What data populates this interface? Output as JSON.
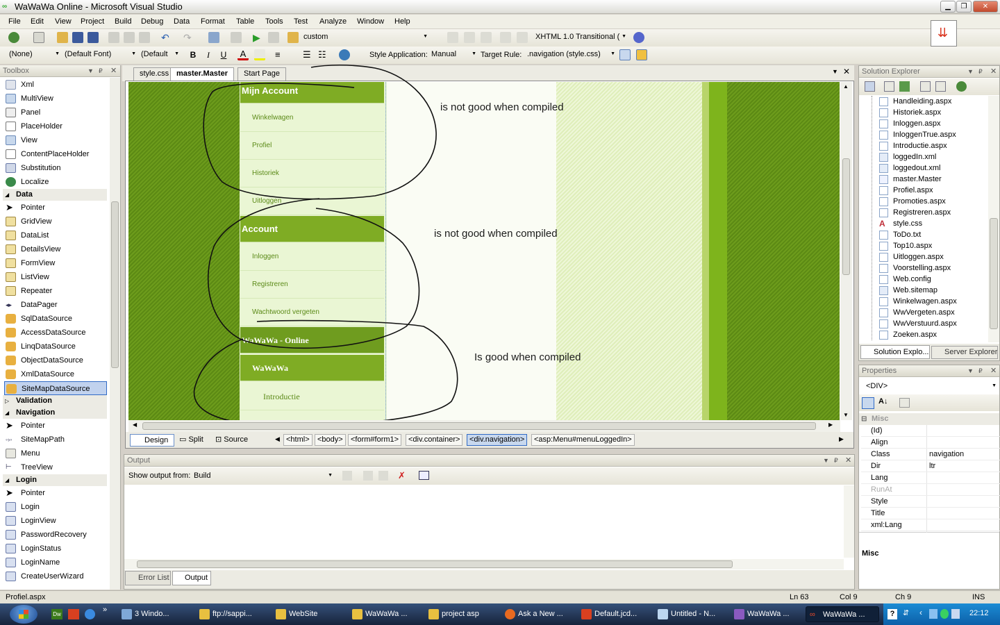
{
  "window": {
    "title": "WaWaWa Online - Microsoft Visual Studio"
  },
  "menu": [
    "File",
    "Edit",
    "View",
    "Project",
    "Build",
    "Debug",
    "Data",
    "Format",
    "Table",
    "Tools",
    "Test",
    "Analyze",
    "Window",
    "Help"
  ],
  "toolbar1": {
    "config": "custom",
    "doctype": "XHTML 1.0 Transitional ("
  },
  "toolbar2": {
    "style": "(None)",
    "font": "(Default Font)",
    "size": "(Default",
    "style_app_label": "Style Application:",
    "style_app": "Manual",
    "target_label": "Target Rule:",
    "target": ".navigation (style.css)"
  },
  "toolbox": {
    "title": "Toolbox",
    "items_top": [
      "Xml",
      "MultiView",
      "Panel",
      "PlaceHolder",
      "View",
      "ContentPlaceHolder",
      "Substitution",
      "Localize"
    ],
    "data_header": "Data",
    "data_items": [
      "Pointer",
      "GridView",
      "DataList",
      "DetailsView",
      "FormView",
      "ListView",
      "Repeater",
      "DataPager",
      "SqlDataSource",
      "AccessDataSource",
      "LinqDataSource",
      "ObjectDataSource",
      "XmlDataSource",
      "SiteMapDataSource"
    ],
    "validation_header": "Validation",
    "navigation_header": "Navigation",
    "navigation_items": [
      "Pointer",
      "SiteMapPath",
      "Menu",
      "TreeView"
    ],
    "login_header": "Login",
    "login_items": [
      "Pointer",
      "Login",
      "LoginView",
      "PasswordRecovery",
      "LoginStatus",
      "LoginName",
      "CreateUserWizard"
    ]
  },
  "doc_tabs": [
    "style.css",
    "master.Master",
    "Start Page"
  ],
  "design": {
    "menu1_header": "Mijn Account",
    "menu1_items": [
      "Winkelwagen",
      "Profiel",
      "Historiek",
      "Uitloggen"
    ],
    "menu2_header": "Account",
    "menu2_items": [
      "Inloggen",
      "Registreren",
      "Wachtwoord vergeten"
    ],
    "menu3_header": "WaWaWa - Online",
    "menu3_sub": "WaWaWa",
    "menu3_items": [
      "Introductie"
    ],
    "annotation1": "is not good when compiled",
    "annotation2": "is not good when compiled",
    "annotation3": "Is good when compiled"
  },
  "view_tabs": [
    "Design",
    "Split",
    "Source"
  ],
  "breadcrumb": [
    "<html>",
    "<body>",
    "<form#form1>",
    "<div.container>",
    "<div.navigation>",
    "<asp:Menu#menuLoggedIn>"
  ],
  "output": {
    "title": "Output",
    "show_label": "Show output from:",
    "source": "Build"
  },
  "bottom_tabs": [
    "Error List",
    "Output"
  ],
  "solution_explorer": {
    "title": "Solution Explorer",
    "files": [
      "Handleiding.aspx",
      "Historiek.aspx",
      "Inloggen.aspx",
      "InloggenTrue.aspx",
      "Introductie.aspx",
      "loggedIn.xml",
      "loggedout.xml",
      "master.Master",
      "Profiel.aspx",
      "Promoties.aspx",
      "Registreren.aspx",
      "style.css",
      "ToDo.txt",
      "Top10.aspx",
      "Uitloggen.aspx",
      "Voorstelling.aspx",
      "Web.config",
      "Web.sitemap",
      "Winkelwagen.aspx",
      "WwVergeten.aspx",
      "WwVerstuurd.aspx",
      "Zoeken.aspx"
    ],
    "tabs": [
      "Solution Explo...",
      "Server Explorer"
    ]
  },
  "properties": {
    "title": "Properties",
    "object": "<DIV>",
    "category": "Misc",
    "rows": [
      {
        "name": "(Id)",
        "value": ""
      },
      {
        "name": "Align",
        "value": ""
      },
      {
        "name": "Class",
        "value": "navigation"
      },
      {
        "name": "Dir",
        "value": "ltr"
      },
      {
        "name": "Lang",
        "value": ""
      },
      {
        "name": "RunAt",
        "value": ""
      },
      {
        "name": "Style",
        "value": ""
      },
      {
        "name": "Title",
        "value": ""
      },
      {
        "name": "xml:Lang",
        "value": ""
      }
    ],
    "desc": "Misc"
  },
  "status": {
    "file": "Profiel.aspx",
    "ln": "Ln 63",
    "col": "Col 9",
    "ch": "Ch 9",
    "mode": "INS"
  },
  "taskbar": {
    "items": [
      "3 Windo...",
      "ftp://sappi...",
      "WebSite",
      "WaWaWa ...",
      "project asp",
      "Ask a New ...",
      "Default.jcd...",
      "Untitled - N...",
      "WaWaWa ...",
      "WaWaWa ..."
    ],
    "clock": "22:12"
  }
}
